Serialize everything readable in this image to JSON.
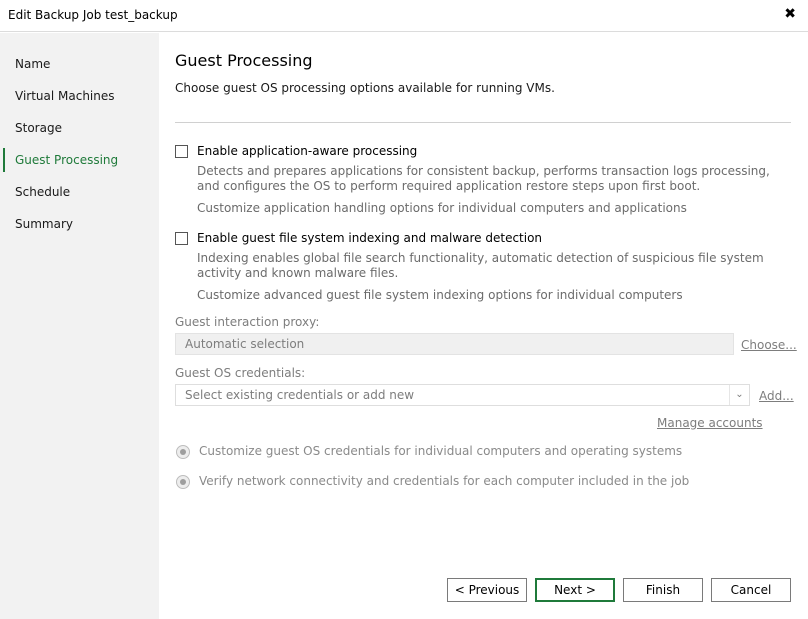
{
  "window": {
    "title": "Edit Backup Job test_backup",
    "close_glyph": "✖"
  },
  "sidebar": {
    "items": [
      {
        "label": "Name",
        "active": false
      },
      {
        "label": "Virtual Machines",
        "active": false
      },
      {
        "label": "Storage",
        "active": false
      },
      {
        "label": "Guest Processing",
        "active": true
      },
      {
        "label": "Schedule",
        "active": false
      },
      {
        "label": "Summary",
        "active": false
      }
    ]
  },
  "main": {
    "title": "Guest Processing",
    "subtitle": "Choose guest OS processing options available for running VMs.",
    "app_aware": {
      "label": "Enable application-aware processing",
      "checked": false,
      "desc1": "Detects and prepares applications for consistent backup, performs transaction logs processing, and configures the OS to perform required application restore steps upon first boot.",
      "desc2": "Customize application handling options for individual computers and applications"
    },
    "indexing": {
      "label": "Enable guest file system indexing and malware detection",
      "checked": false,
      "desc1": "Indexing enables global file search functionality, automatic detection of suspicious file system activity and known malware files.",
      "desc2": "Customize advanced guest file system indexing options for individual computers"
    },
    "proxy": {
      "label": "Guest interaction proxy:",
      "value": "Automatic selection",
      "choose": "Choose..."
    },
    "credentials": {
      "label": "Guest OS credentials:",
      "placeholder": "Select existing credentials or add new",
      "add": "Add...",
      "manage": "Manage accounts"
    },
    "radios": [
      {
        "label": "Customize guest OS credentials for individual computers and operating systems"
      },
      {
        "label": "Verify network connectivity and credentials for each computer included in the job"
      }
    ]
  },
  "footer": {
    "previous": "< Previous",
    "next": "Next >",
    "finish": "Finish",
    "cancel": "Cancel"
  },
  "colors": {
    "accent": "#1f7a3a",
    "sidebar_bg": "#f2f2f2",
    "disabled_text": "#7d7d7d"
  },
  "icons": {
    "close": "close-icon",
    "dropdown": "chevron-down-icon"
  }
}
